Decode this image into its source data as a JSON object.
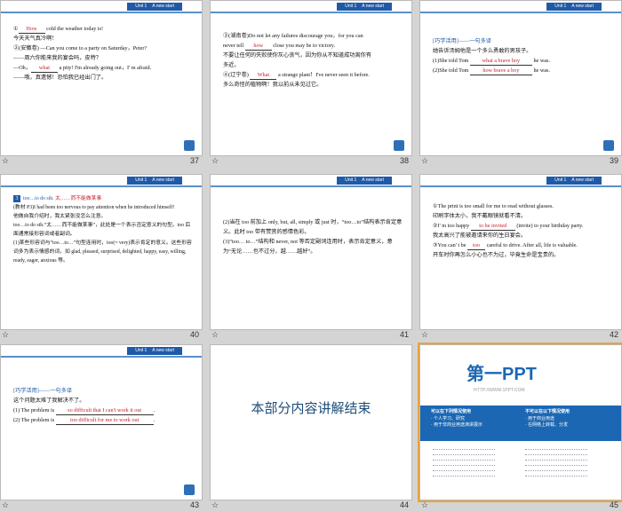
{
  "header_tag": {
    "unit": "Unit 1",
    "title": "A new start"
  },
  "slides": {
    "s37": {
      "num": "37",
      "l1a": "①",
      "l1b": "How",
      "l1c": " cold the weather today is!",
      "l2": "今天天气真冷啊！",
      "l3": "②(安徽卷) —Can you come to a party on Saturday，Peter?",
      "l4": "——周六你能来我的宴会吗，皮特？",
      "l5a": "—Oh，",
      "l5b": "what",
      "l5c": " a pity! I'm already going out，I' m afraid.",
      "l6": "——哦，真遗憾！恐怕我已经出门了。"
    },
    "s38": {
      "num": "38",
      "l1": "③(湖南卷)Do not let any failures discourage you，for you can",
      "l2a": "never tell ",
      "l2b": "how",
      "l2c": " close you may be to victory.",
      "l3": "不要让任何的失败使你灰心丧气，因为你从不知道成功离你有",
      "l4": "多近。",
      "l5a": "④(辽宁卷) ",
      "l5b": "What",
      "l5c": " a strange plant！I've never seen it before.",
      "l6": "多么奇怪的植物啊！我以前从未见过它。"
    },
    "s39": {
      "num": "39",
      "l1": "[巧学活用]——一句多译",
      "l2": "她告诉汤姆他是一个多么勇敢的男孩子。",
      "l3a": "(1)She told Tom ",
      "l3b": "what a brave boy",
      "l3c": " he was.",
      "l4a": "(2)She told Tom ",
      "l4b": "how brave a boy",
      "l4c": " he was."
    },
    "s40": {
      "num": "40",
      "badge": "3",
      "h1": "too…to do sth.",
      "h2": " 太……而不能做某事",
      "l1": "(教材 P3)I had been too nervous to pay attention when he introduced himself!",
      "l2": "他做自我介绍时，我太紧张没怎么注意。",
      "l3": "too…to do sth.“太……而不能做某事”，此处是一个表示否定意义的句型。too 后面通常接形容词或者副词。",
      "l4": "(1)某些形容词与“too…to…”句型连用时，too(= very)表示肯定的意义。这些形容词多为表示情感的词，如 glad, pleased, surprised, delighted, happy, easy, willing, ready, eager, anxious 等。"
    },
    "s41": {
      "num": "41",
      "l1": "(2)当在 too 前加上 only, but, all, simply 或 just 时，“too…to”结构表示肯定意义。此时 too 带有赞赏的感情色彩。",
      "l2": "(3)“too… to…”结构和 never, not 等否定副词连用时，表示肯定意义，意为“无论……也不过分，越……越好”。"
    },
    "s42": {
      "num": "42",
      "l1": "①The print is too small for me to read without glasses.",
      "l2": "印刷字体太小，我不戴眼镜就看不清。",
      "l3a": "②I' m too happy ",
      "l3b": "to be invited",
      "l3c": " (invite) to your birthday party.",
      "l4": "我太高兴了能被邀请来你的生日宴会。",
      "l5a": "③You can' t be ",
      "l5b": "too",
      "l5c": " careful to drive. After all, life is valuable.",
      "l6": "开车时你再怎么小心也不为过，毕竟生命是宝贵的。"
    },
    "s43": {
      "num": "43",
      "l1": "[巧学活用]——一句多译",
      "l2": "这个问题太难了我解决不了。",
      "l3a": "(1) The problem is ",
      "l3b": "so difficult that I can't work it out",
      "l3c": ".",
      "l4a": "(2) The problem is ",
      "l4b": "too difficult for me to work out",
      "l4c": "."
    },
    "s44": {
      "num": "44",
      "title": "本部分内容讲解结束"
    },
    "s45": {
      "num": "45",
      "logo": "第一PPT",
      "url": "HTTP://WWW.1PPT.COM",
      "left_head": "可以在下列情况使用",
      "left_1": "· 个人学习、研究",
      "left_2": "· 用于非商业用途演讲展示",
      "right_head": "不可以在以下情况使用",
      "right_1": "· 用于商业用途",
      "right_2": "· 在网络上转载、分发"
    }
  }
}
